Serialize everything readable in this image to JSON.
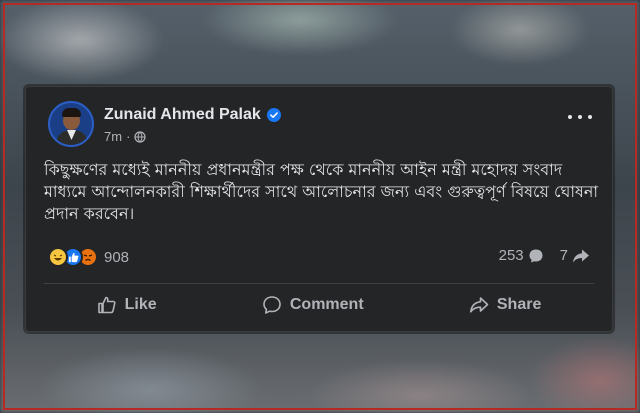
{
  "post": {
    "author": "Zunaid Ahmed Palak",
    "time": "7m",
    "privacy_icon": "globe-icon",
    "text": "কিছুক্ষণের মধ্যেই মাননীয় প্রধানমন্ত্রীর পক্ষ থেকে মাননীয় আইন মন্ত্রী মহোদয় সংবাদ মাধ্যমে আন্দোলনকারী শিক্ষার্থীদের সাথে আলোচনার জন্য এবং গুরুত্বপূর্ণ বিষয়ে ঘোষনা প্রদান করবেন।",
    "reactions": {
      "types": [
        "haha",
        "like",
        "angry"
      ],
      "count": "908"
    },
    "comments_count": "253",
    "shares_count": "7"
  },
  "actions": {
    "like_label": "Like",
    "comment_label": "Comment",
    "share_label": "Share"
  },
  "colors": {
    "card_bg": "#242526",
    "text_primary": "#e4e6eb",
    "text_secondary": "#b0b3b8",
    "verified_blue": "#1877f2",
    "frame_red": "#b52a23"
  }
}
